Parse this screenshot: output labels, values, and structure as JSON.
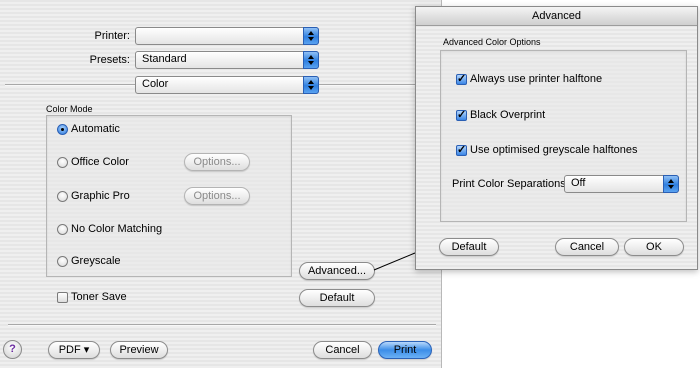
{
  "print_dialog": {
    "printer_label": "Printer:",
    "printer_value": "",
    "presets_label": "Presets:",
    "presets_value": "Standard",
    "panel_value": "Color",
    "color_mode_title": "Color Mode",
    "color_modes": [
      {
        "label": "Automatic",
        "selected": true
      },
      {
        "label": "Office Color",
        "selected": false
      },
      {
        "label": "Graphic Pro",
        "selected": false
      },
      {
        "label": "No Color Matching",
        "selected": false
      },
      {
        "label": "Greyscale",
        "selected": false
      }
    ],
    "options_label": "Options...",
    "advanced_button": "Advanced...",
    "toner_save_label": "Toner Save",
    "toner_save_checked": false,
    "default_button": "Default",
    "help_symbol": "?",
    "pdf_button": "PDF ▾",
    "preview_button": "Preview",
    "cancel_button": "Cancel",
    "print_button": "Print"
  },
  "advanced_sheet": {
    "title": "Advanced",
    "group_title": "Advanced Color Options",
    "options": [
      {
        "label": "Always use printer halftone",
        "checked": true
      },
      {
        "label": "Black Overprint",
        "checked": true
      },
      {
        "label": "Use optimised greyscale halftones",
        "checked": true
      }
    ],
    "separations_label": "Print Color Separations:",
    "separations_value": "Off",
    "default_button": "Default",
    "cancel_button": "Cancel",
    "ok_button": "OK"
  },
  "colors": {
    "accent_blue": "#2f7fe0",
    "dialog_bg": "#ececec"
  }
}
